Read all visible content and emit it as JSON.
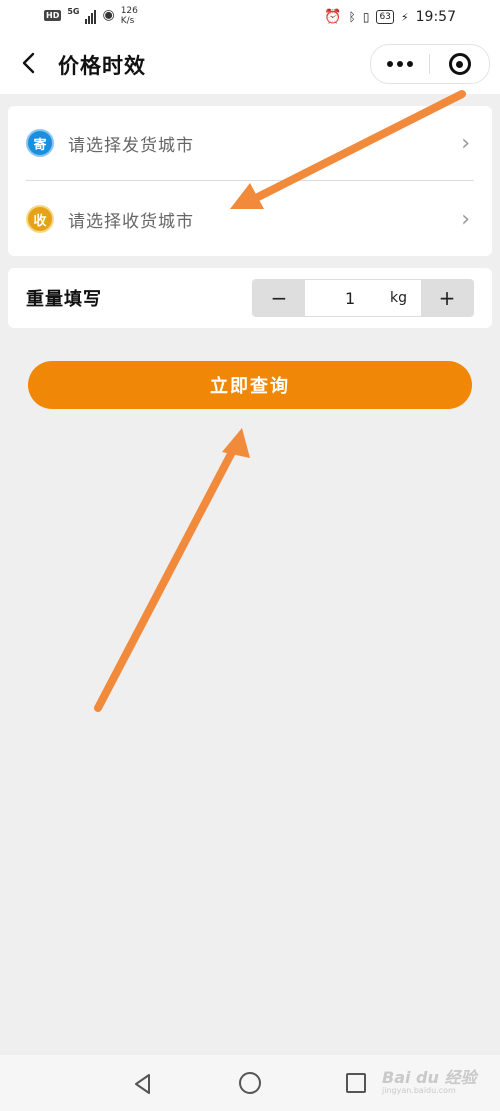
{
  "status_bar": {
    "network_badge": "HD",
    "signal_label": "5G",
    "net_speed_value": "126",
    "net_speed_unit": "K/s",
    "battery": "63",
    "time": "19:57"
  },
  "navbar": {
    "title": "价格时效",
    "back_icon": "chevron-left-icon",
    "more_icon": "more-dots-icon",
    "close_icon": "target-circle-icon"
  },
  "city_select": {
    "send": {
      "badge": "寄",
      "placeholder": "请选择发货城市",
      "badge_color": "#1a8fe0"
    },
    "receive": {
      "badge": "收",
      "placeholder": "请选择收货城市",
      "badge_color": "#e6a217"
    }
  },
  "weight": {
    "label": "重量填写",
    "minus": "−",
    "value": "1",
    "unit": "kg",
    "plus": "+"
  },
  "query_button": {
    "label": "立即查询",
    "color": "#f08707"
  },
  "annotation_color": "#f28a3c",
  "watermark": {
    "text": "Bai du 经验",
    "sub": "jingyan.baidu.com"
  }
}
